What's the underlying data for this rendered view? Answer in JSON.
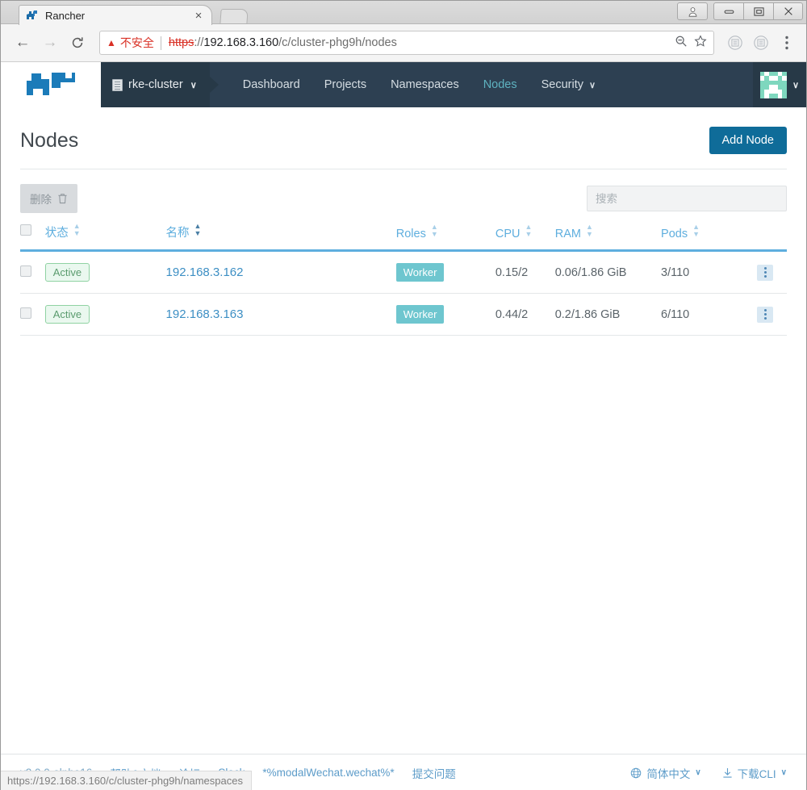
{
  "browser": {
    "tab": {
      "title": "Rancher",
      "favicon": "rancher-logo-icon",
      "close_label": "×"
    },
    "nav": {
      "back": "←",
      "forward": "→",
      "reload": "⟳"
    },
    "omnibox": {
      "warning_icon": "warning-triangle-icon",
      "security_label": "不安全",
      "url_scheme": "https",
      "url_sep": "://",
      "url_host": "192.168.3.160",
      "url_path": "/c/cluster-phg9h/nodes",
      "zoom_icon": "zoom-out-icon",
      "bookmark_icon": "star-icon"
    },
    "extensions": [
      "extension-icon-1",
      "extension-icon-2"
    ],
    "menu_icon": "kebab-menu-icon",
    "window_controls": {
      "profile": "\u0000",
      "minimize": "—",
      "maximize": "□",
      "close": "✕"
    }
  },
  "topnav": {
    "logo": "rancher-cow-logo",
    "cluster": {
      "icon": "cluster-icon",
      "name": "rke-cluster",
      "chevron": "∨"
    },
    "links": [
      {
        "label": "Dashboard",
        "active": false,
        "has_chevron": false
      },
      {
        "label": "Projects",
        "active": false,
        "has_chevron": false
      },
      {
        "label": "Namespaces",
        "active": false,
        "has_chevron": false
      },
      {
        "label": "Nodes",
        "active": true,
        "has_chevron": false
      },
      {
        "label": "Security",
        "active": false,
        "has_chevron": true
      }
    ],
    "user": {
      "avatar": "user-avatar-identicon",
      "chevron": "∨"
    }
  },
  "page": {
    "title": "Nodes",
    "add_node_label": "Add Node"
  },
  "toolbar": {
    "delete_label": "删除",
    "delete_icon": "trash-icon",
    "search_placeholder": "搜索",
    "search_value": ""
  },
  "table": {
    "columns": [
      {
        "label": "",
        "key": "checkbox",
        "sortable": false,
        "sorted": false
      },
      {
        "label": "状态",
        "key": "state",
        "sortable": true,
        "sorted": false
      },
      {
        "label": "名称",
        "key": "name",
        "sortable": true,
        "sorted": true
      },
      {
        "label": "Roles",
        "key": "roles",
        "sortable": true,
        "sorted": false
      },
      {
        "label": "CPU",
        "key": "cpu",
        "sortable": true,
        "sorted": false
      },
      {
        "label": "RAM",
        "key": "ram",
        "sortable": true,
        "sorted": false
      },
      {
        "label": "Pods",
        "key": "pods",
        "sortable": true,
        "sorted": false
      },
      {
        "label": "",
        "key": "actions",
        "sortable": false,
        "sorted": false
      }
    ],
    "rows": [
      {
        "selected": false,
        "state": "Active",
        "name": "192.168.3.162",
        "role": "Worker",
        "cpu": "0.15/2",
        "ram": "0.06/1.86 GiB",
        "pods": "3/110",
        "actions_icon": "vertical-dots-icon"
      },
      {
        "selected": false,
        "state": "Active",
        "name": "192.168.3.163",
        "role": "Worker",
        "cpu": "0.44/2",
        "ram": "0.2/1.86 GiB",
        "pods": "6/110",
        "actions_icon": "vertical-dots-icon"
      }
    ]
  },
  "footer": {
    "version": "v2.0.0-alpha16",
    "links": [
      "帮助&文档",
      "论坛",
      "Slack",
      "*%modalWechat.wechat%*",
      "提交问题"
    ],
    "language": {
      "icon": "globe-icon",
      "label": "简体中文",
      "chevron": "∨"
    },
    "cli": {
      "icon": "download-icon",
      "label": "下载CLI",
      "chevron": "∨"
    }
  },
  "status_bubble": {
    "url": "https://192.168.3.160/c/cluster-phg9h/namespaces"
  },
  "colors": {
    "nav_bg": "#2d4052",
    "cluster_bg": "#273947",
    "accent_blue": "#0f6c99",
    "link_blue": "#3d8fc4",
    "header_blue": "#5eaede",
    "badge_active_border": "#8fd2a2",
    "badge_role_bg": "#6ec6cf",
    "avatar_bg": "#7ed7be",
    "insecure_red": "#d93025"
  }
}
